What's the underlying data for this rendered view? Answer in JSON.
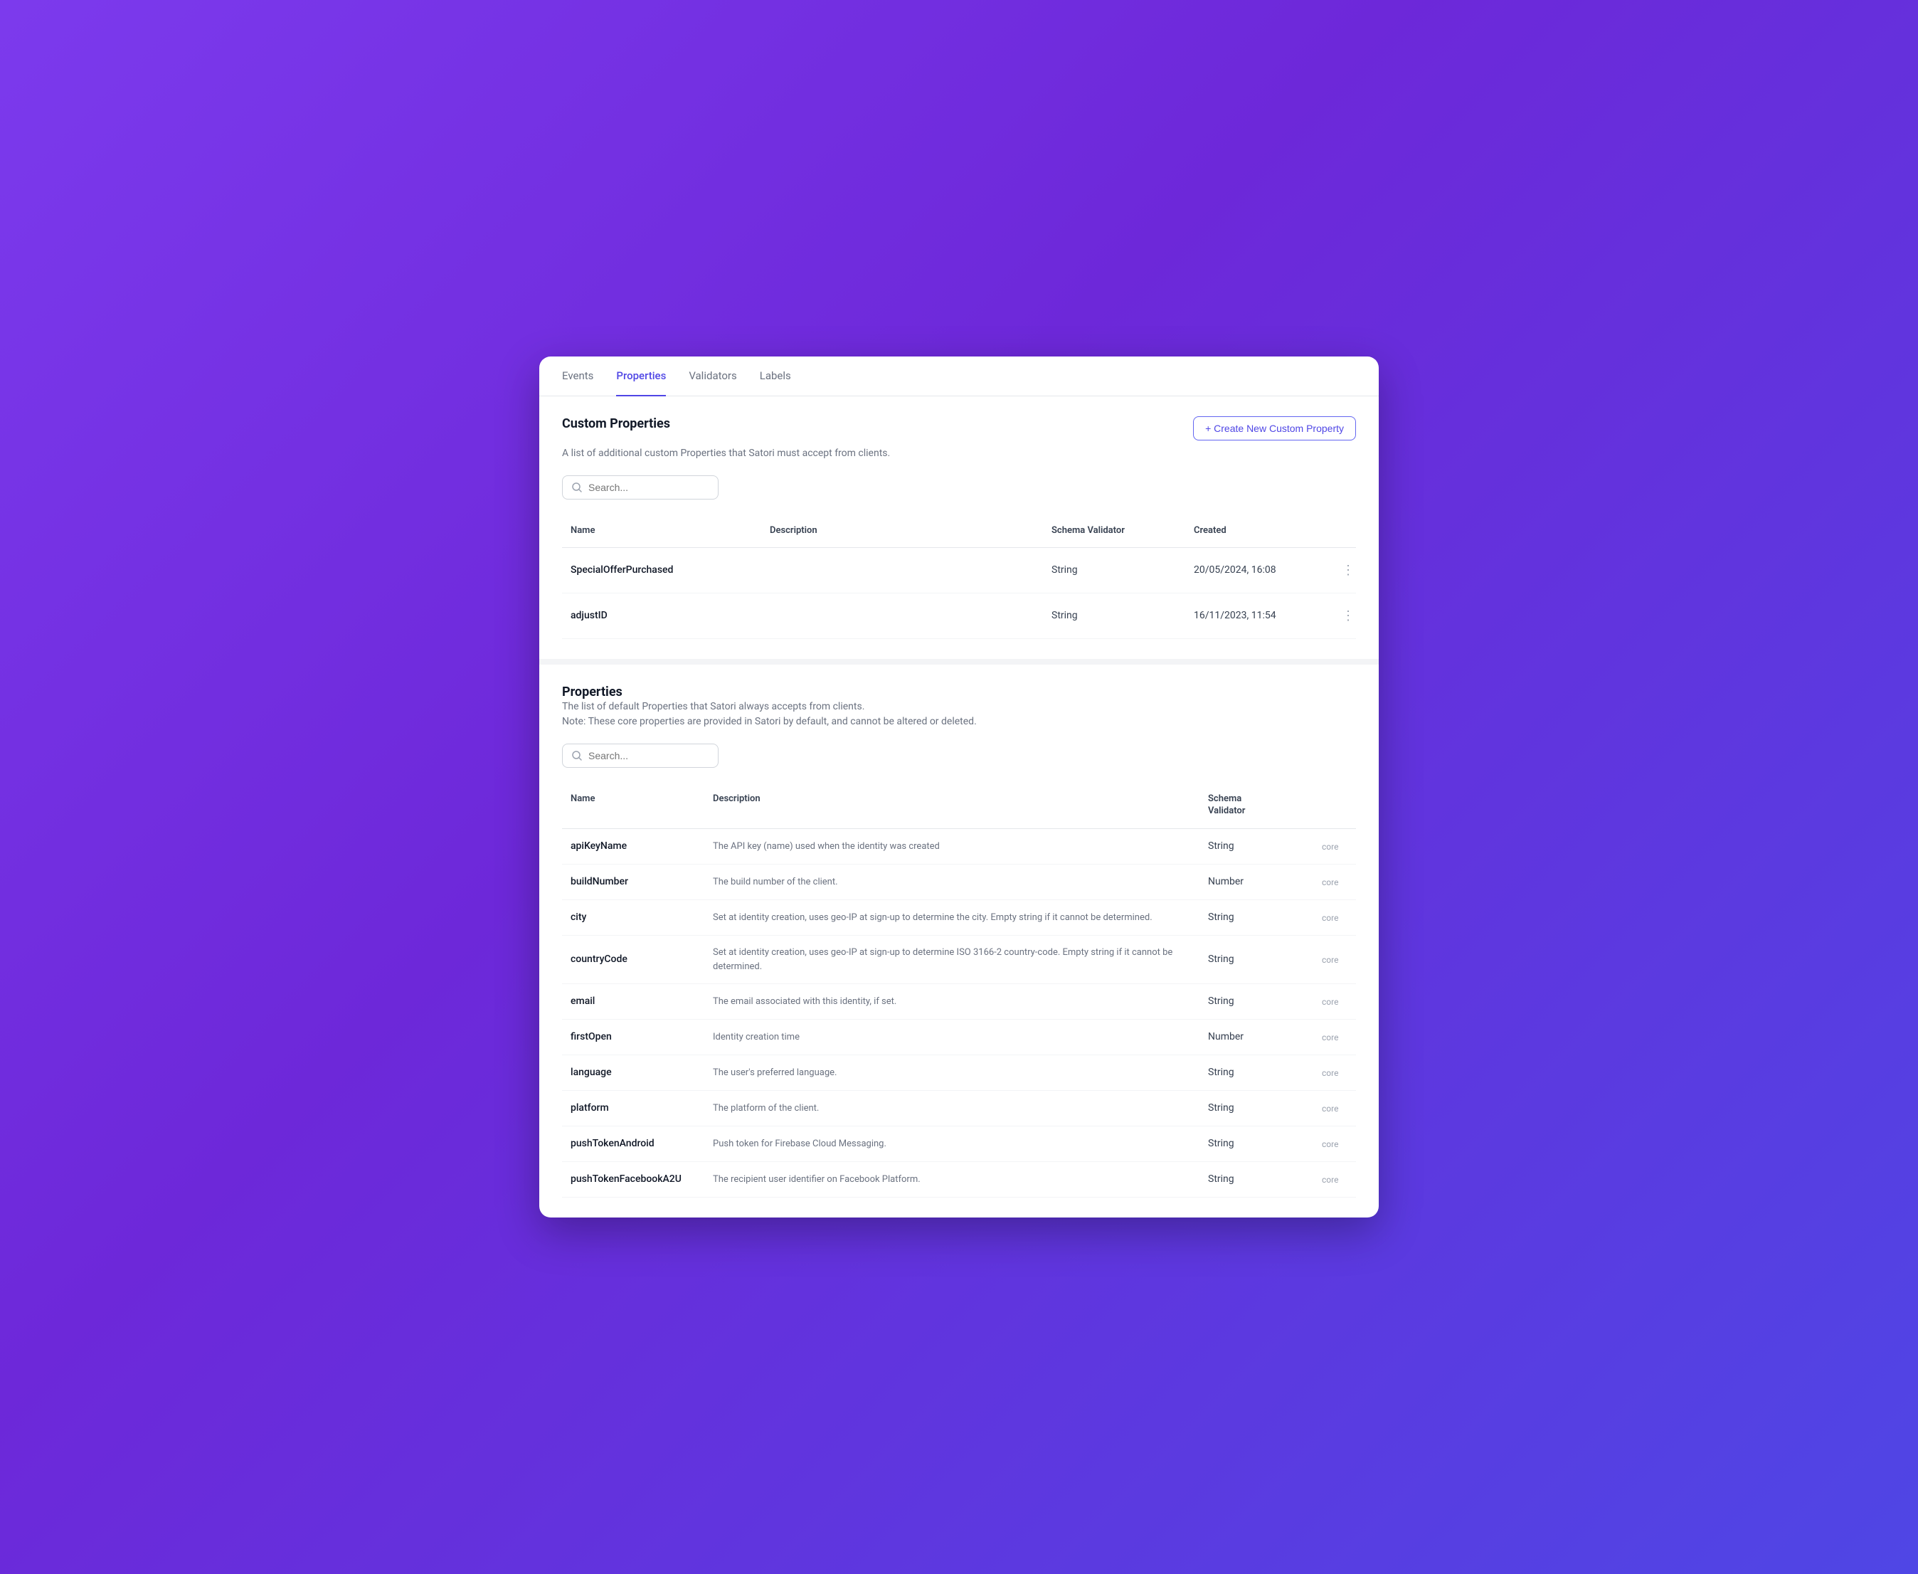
{
  "tabs": [
    {
      "label": "Events",
      "active": false
    },
    {
      "label": "Properties",
      "active": true
    },
    {
      "label": "Validators",
      "active": false
    },
    {
      "label": "Labels",
      "active": false
    }
  ],
  "customProperties": {
    "title": "Custom Properties",
    "subtitle": "A list of additional custom Properties that Satori must accept from clients.",
    "createButton": "+ Create New Custom Property",
    "searchPlaceholder": "Search...",
    "columns": [
      "Name",
      "Description",
      "Schema Validator",
      "Created",
      ""
    ],
    "rows": [
      {
        "name": "SpecialOfferPurchased",
        "description": "",
        "schemaValidator": "String",
        "created": "20/05/2024, 16:08"
      },
      {
        "name": "adjustID",
        "description": "",
        "schemaValidator": "String",
        "created": "16/11/2023, 11:54"
      }
    ]
  },
  "properties": {
    "title": "Properties",
    "subtitle1": "The list of default Properties that Satori always accepts from clients.",
    "subtitle2": "Note: These core properties are provided in Satori by default, and cannot be altered or deleted.",
    "searchPlaceholder": "Search...",
    "columns": [
      "Name",
      "Description",
      "Schema\nValidator",
      ""
    ],
    "rows": [
      {
        "name": "apiKeyName",
        "description": "The API key (name) used when the identity was created",
        "schemaValidator": "String",
        "badge": "core"
      },
      {
        "name": "buildNumber",
        "description": "The build number of the client.",
        "schemaValidator": "Number",
        "badge": "core"
      },
      {
        "name": "city",
        "description": "Set at identity creation, uses geo-IP at sign-up to determine the city. Empty string if it cannot be determined.",
        "schemaValidator": "String",
        "badge": "core"
      },
      {
        "name": "countryCode",
        "description": "Set at identity creation, uses geo-IP at sign-up to determine ISO 3166-2 country-code. Empty string if it cannot be determined.",
        "schemaValidator": "String",
        "badge": "core"
      },
      {
        "name": "email",
        "description": "The email associated with this identity, if set.",
        "schemaValidator": "String",
        "badge": "core"
      },
      {
        "name": "firstOpen",
        "description": "Identity creation time",
        "schemaValidator": "Number",
        "badge": "core"
      },
      {
        "name": "language",
        "description": "The user's preferred language.",
        "schemaValidator": "String",
        "badge": "core"
      },
      {
        "name": "platform",
        "description": "The platform of the client.",
        "schemaValidator": "String",
        "badge": "core"
      },
      {
        "name": "pushTokenAndroid",
        "description": "Push token for Firebase Cloud Messaging.",
        "schemaValidator": "String",
        "badge": "core"
      },
      {
        "name": "pushTokenFacebookA2U",
        "description": "The recipient user identifier on Facebook Platform.",
        "schemaValidator": "String",
        "badge": "core"
      }
    ]
  }
}
